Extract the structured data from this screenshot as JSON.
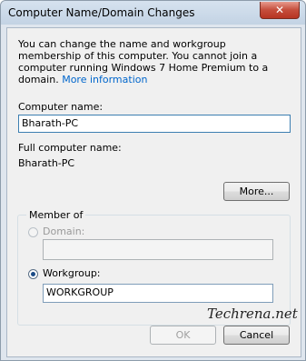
{
  "window": {
    "title": "Computer Name/Domain Changes",
    "close_label": "✕"
  },
  "intro": {
    "text": "You can change the name and workgroup membership of this computer. You cannot join a computer running Windows 7 Home Premium to a domain. ",
    "link": "More information"
  },
  "computer_name": {
    "label": "Computer name:",
    "value": "Bharath-PC"
  },
  "full_name": {
    "label": "Full computer name:",
    "value": "Bharath-PC"
  },
  "more_button": "More...",
  "member_of": {
    "legend": "Member of",
    "domain_label": "Domain:",
    "domain_value": "",
    "workgroup_label": "Workgroup:",
    "workgroup_value": "WORKGROUP",
    "selected": "workgroup"
  },
  "watermark": "Techrena.net",
  "buttons": {
    "ok": "OK",
    "cancel": "Cancel"
  },
  "colors": {
    "link": "#0066cc",
    "close_button": "#c54d3b"
  }
}
